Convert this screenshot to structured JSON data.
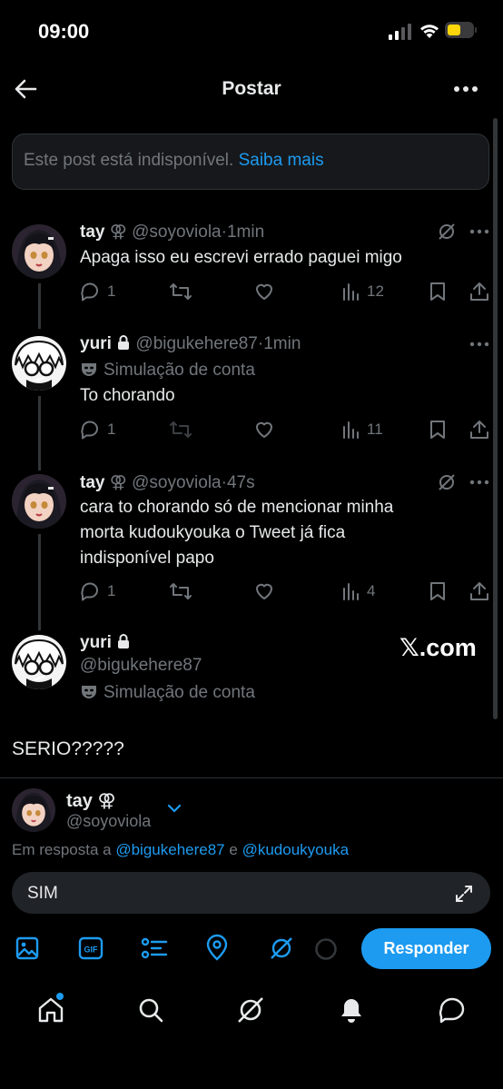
{
  "status_bar": {
    "time": "09:00"
  },
  "header": {
    "title": "Postar"
  },
  "unavailable": {
    "text": "Este post está indisponível.",
    "link": "Saiba mais"
  },
  "posts": [
    {
      "name": "tay",
      "badge": "⚢",
      "handle": "@soyoviola",
      "time": "1min",
      "text": "Apaga isso eu escrevi errado paguei migo",
      "replies": "1",
      "views": "12"
    },
    {
      "name": "yuri",
      "handle": "@bigukehere87",
      "time": "1min",
      "simulation": "Simulação de conta",
      "text": "To chorando",
      "replies": "1",
      "views": "11"
    },
    {
      "name": "tay",
      "badge": "⚢",
      "handle": "@soyoviola",
      "time": "47s",
      "text_lines": [
        "cara to chorando só de mencionar minha",
        "morta kudoukyouka o Tweet já fica",
        "indisponível papo"
      ],
      "replies": "1",
      "views": "4"
    }
  ],
  "main_post": {
    "name": "yuri",
    "handle": "@bigukehere87",
    "simulation": "Simulação de conta",
    "source": "𝕏.com",
    "text": "SERIO?????"
  },
  "reply": {
    "name": "tay",
    "badge": "⚢",
    "handle": "@soyoviola",
    "replying_prefix": "Em resposta a",
    "mention1": "@bigukehere87",
    "conj": "e",
    "mention2": "@kudoukyouka",
    "input_value": "SIM",
    "button": "Responder"
  },
  "colors": {
    "accent": "#1d9bf0",
    "background": "#000000",
    "muted": "#71767b"
  }
}
